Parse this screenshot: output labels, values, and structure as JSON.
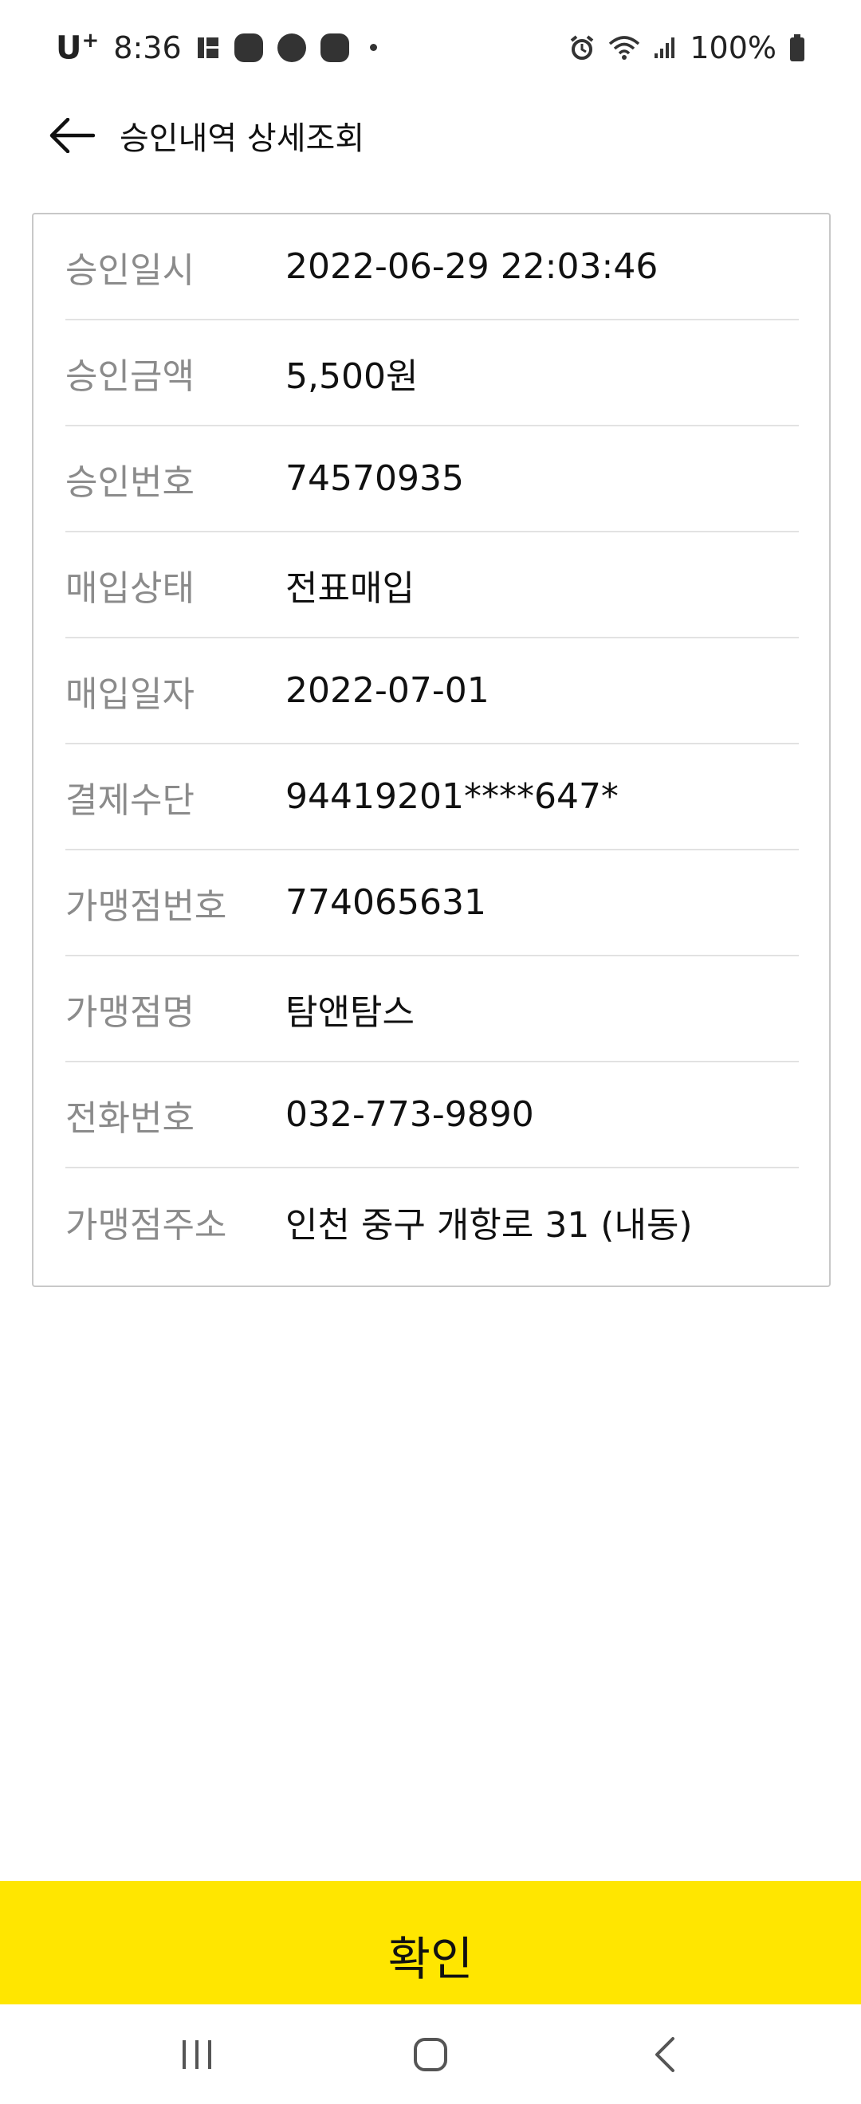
{
  "status_bar": {
    "carrier": "U",
    "carrier_sup": "+",
    "time": "8:36",
    "battery": "100%"
  },
  "header": {
    "title": "승인내역 상세조회"
  },
  "details": [
    {
      "label": "승인일시",
      "value": "2022-06-29 22:03:46"
    },
    {
      "label": "승인금액",
      "value": "5,500원"
    },
    {
      "label": "승인번호",
      "value": "74570935"
    },
    {
      "label": "매입상태",
      "value": "전표매입"
    },
    {
      "label": "매입일자",
      "value": "2022-07-01"
    },
    {
      "label": "결제수단",
      "value": "94419201****647*"
    },
    {
      "label": "가맹점번호",
      "value": "774065631"
    },
    {
      "label": "가맹점명",
      "value": "탐앤탐스"
    },
    {
      "label": "전화번호",
      "value": "032-773-9890"
    },
    {
      "label": "가맹점주소",
      "value": "인천 중구 개항로 31 (내동)"
    }
  ],
  "confirm": {
    "label": "확인",
    "color": "#ffe600"
  },
  "icons": {
    "back": "arrow-left-icon",
    "alarm": "alarm-icon",
    "wifi": "wifi-icon",
    "signal": "signal-icon",
    "battery": "battery-icon",
    "recents": "recents-icon",
    "home": "home-icon",
    "nav_back": "chevron-left-icon"
  }
}
